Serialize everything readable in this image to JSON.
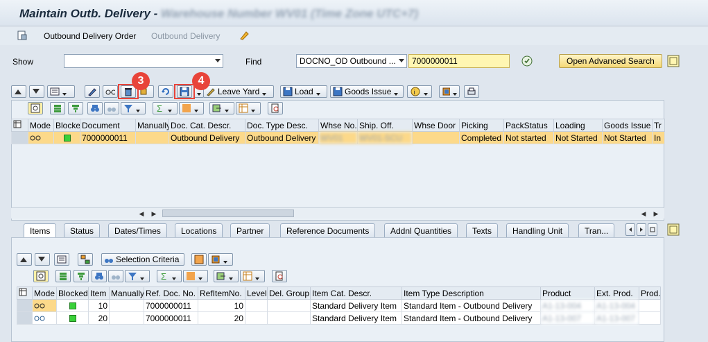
{
  "title": {
    "main": "Maintain Outb. Delivery - ",
    "blurred": "Warehouse Number WV01 (Time Zone UTC+7)"
  },
  "menu": {
    "item1": "Outbound Delivery Order",
    "item2": "Outbound Delivery"
  },
  "search": {
    "show_label": "Show",
    "show_value": "",
    "find_label": "Find",
    "find_value": "DOCNO_OD Outbound ...",
    "find_input": "7000000011",
    "advanced_button": "Open Advanced Search"
  },
  "toolbar": {
    "leave_yard": "Leave Yard",
    "load": "Load",
    "goods_issue": "Goods Issue"
  },
  "callouts": {
    "delete": "3",
    "save": "4"
  },
  "upper_table": {
    "headers": [
      "Mode",
      "Blocked",
      "Document",
      "Manually",
      "Doc. Cat. Descr.",
      "Doc. Type Desc.",
      "Whse No.",
      "Ship. Off.",
      "Whse Door",
      "Picking",
      "PackStatus",
      "Loading",
      "Goods Issue",
      "Tr"
    ],
    "rows": [
      {
        "document": "7000000011",
        "doc_cat": "Outbound Delivery",
        "doc_type": "Outbound Delivery",
        "whse": "WV01",
        "ship": "WV01-SCU",
        "picking": "Completed",
        "pack": "Not started",
        "loading": "Not Started",
        "gi": "Not Started",
        "tr": "In"
      }
    ]
  },
  "tabs": [
    "Items",
    "Status",
    "Dates/Times",
    "Locations",
    "Partner",
    "Reference Documents",
    "Addnl Quantities",
    "Texts",
    "Handling Unit",
    "Tran..."
  ],
  "lower_toolbar": {
    "selection_criteria": "Selection Criteria"
  },
  "lower_table": {
    "headers": [
      "Mode",
      "Blocked",
      "Item",
      "Manually",
      "Ref. Doc. No.",
      "RefItemNo.",
      "Level",
      "Del. Group",
      "Item Cat. Descr.",
      "Item Type Description",
      "Product",
      "Ext. Prod.",
      "Prod."
    ],
    "rows": [
      {
        "item": "10",
        "ref_doc": "7000000011",
        "ref_item": "10",
        "item_cat": "Standard Delivery Item",
        "item_type": "Standard Item - Outbound Delivery",
        "product": "A1-13-004",
        "ext": "A1-13-004"
      },
      {
        "item": "20",
        "ref_doc": "7000000011",
        "ref_item": "20",
        "item_cat": "Standard Delivery Item",
        "item_type": "Standard Item - Outbound Delivery",
        "product": "A1-13-007",
        "ext": "A1-13-007"
      }
    ]
  },
  "colors": {
    "accent": "#f4d877",
    "selected_row": "#fcd98a",
    "callout": "#e8443a",
    "status_ok": "#39d039"
  }
}
